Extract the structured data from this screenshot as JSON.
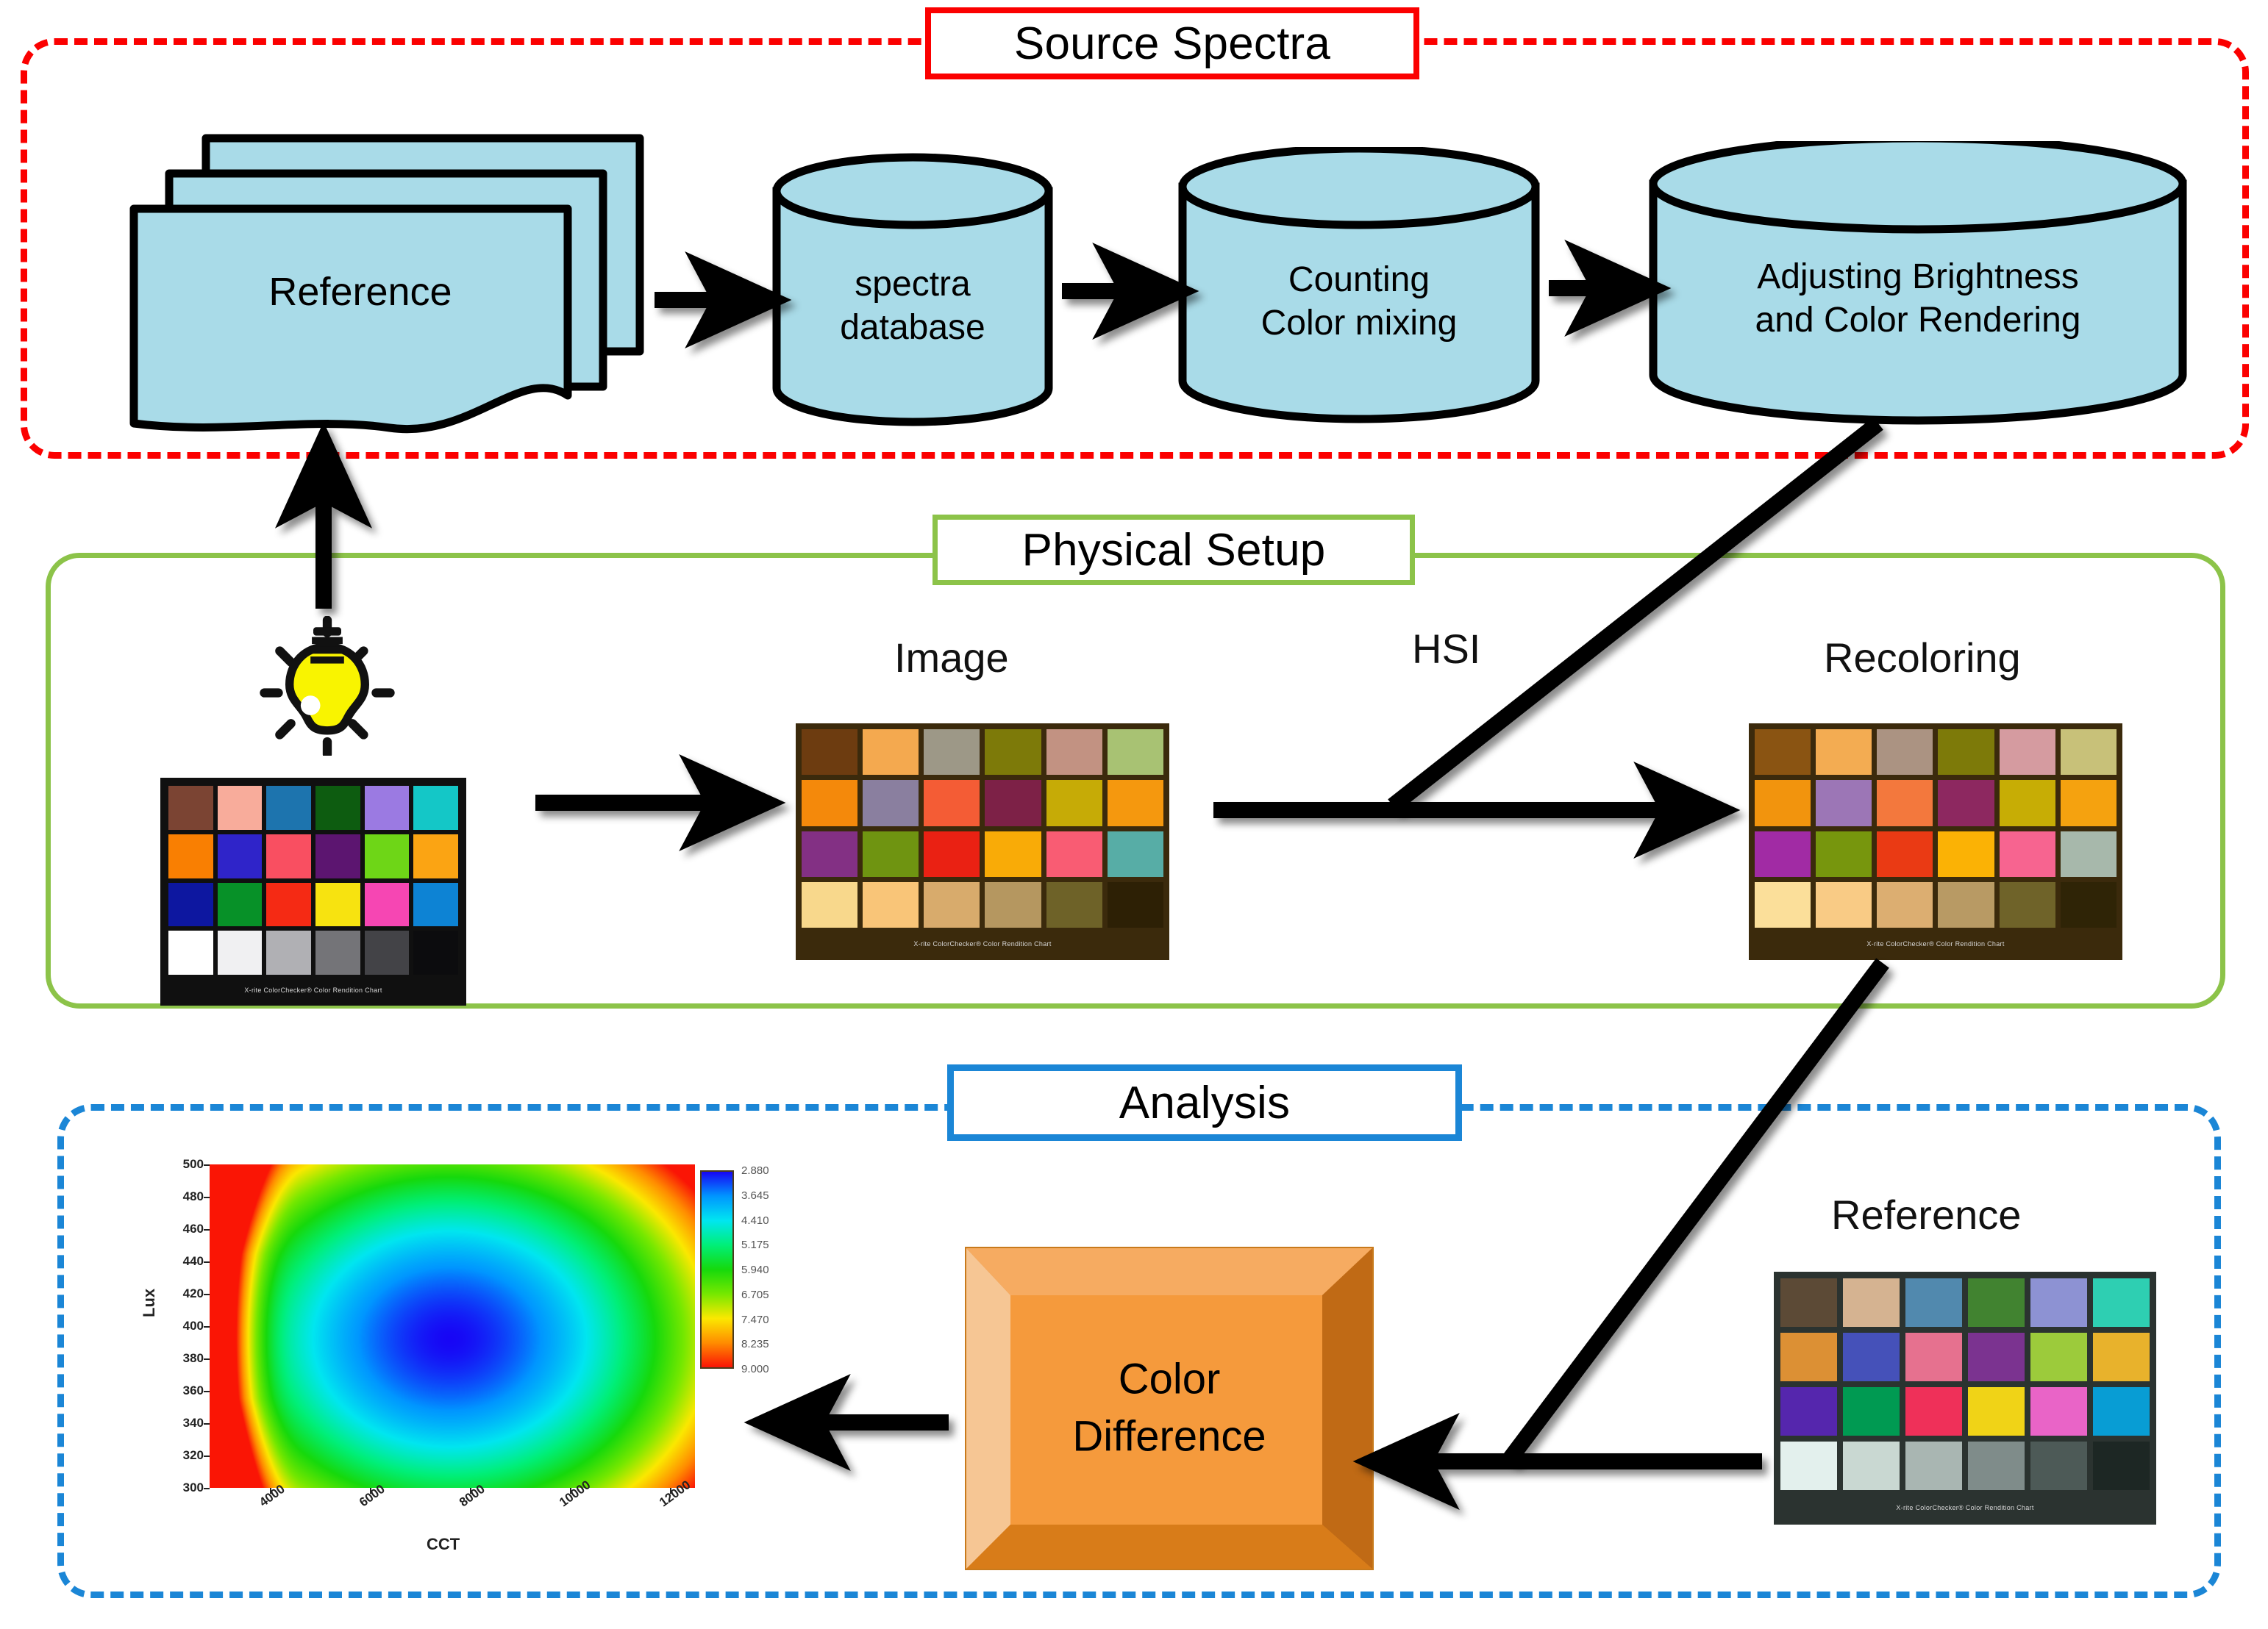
{
  "sections": {
    "source_spectra": {
      "title": "Source Spectra",
      "accent": "#fb0000"
    },
    "physical_setup": {
      "title": "Physical Setup",
      "accent": "#8cc349"
    },
    "analysis": {
      "title": "Analysis",
      "accent": "#1b86d6"
    }
  },
  "source_spectra": {
    "reference_stack_label": "Reference",
    "nodes": [
      {
        "label_line1": "spectra",
        "label_line2": "database"
      },
      {
        "label_line1": "Counting",
        "label_line2": "Color mixing"
      },
      {
        "label_line1": "Adjusting Brightness",
        "label_line2": "and Color Rendering"
      }
    ]
  },
  "physical_setup": {
    "bulb_label": "light-bulb",
    "image_label": "Image",
    "hsi_label": "HSI",
    "recoloring_label": "Recoloring"
  },
  "analysis": {
    "color_difference_line1": "Color",
    "color_difference_line2": "Difference",
    "reference_label": "Reference"
  },
  "colorchecker": {
    "footer": "X-rite ColorChecker® Color Rendition Chart",
    "reference_lit": [
      "#7b4433",
      "#f8ac9b",
      "#1d74ae",
      "#0d5c10",
      "#9b7ae2",
      "#14c7c7",
      "#f97f02",
      "#2f24c9",
      "#f94f61",
      "#5c1570",
      "#6ed617",
      "#fba413",
      "#0d17a0",
      "#079128",
      "#f52a14",
      "#f7e310",
      "#f646b3",
      "#0d83d4",
      "#ffffff",
      "#f0f0f2",
      "#b0b0b4",
      "#747478",
      "#434347",
      "#0c0c0e"
    ],
    "image_captured": [
      "#6d3c10",
      "#f4a94f",
      "#9d9887",
      "#7d7a09",
      "#c29282",
      "#a8c273",
      "#f4890b",
      "#8a7f9f",
      "#f45c35",
      "#7d2147",
      "#c6ab06",
      "#f5980e",
      "#833084",
      "#6f9411",
      "#ea2113",
      "#f9ab07",
      "#f95c73",
      "#57ada6",
      "#f8d88c",
      "#f9c578",
      "#d8ab6c",
      "#b59760",
      "#6e6228",
      "#2d2005"
    ],
    "recolored": [
      "#8a5412",
      "#f3ac52",
      "#ab9382",
      "#7d7a09",
      "#d59ba0",
      "#c8c179",
      "#f2940d",
      "#9c76b6",
      "#f3783d",
      "#8d2860",
      "#c7ad05",
      "#f5a20f",
      "#a12ba4",
      "#77960d",
      "#ea3a14",
      "#fbb205",
      "#f76490",
      "#a7b8ab",
      "#fbdf9a",
      "#f9cb85",
      "#dcae71",
      "#b89a64",
      "#6f6329",
      "#2f2406"
    ],
    "reference_unlit": [
      "#5c4a36",
      "#d5b391",
      "#5189ae",
      "#418330",
      "#8d92d3",
      "#2ecfb2",
      "#dc9034",
      "#4551b9",
      "#e6718f",
      "#7b3390",
      "#9ccb3b",
      "#e8b22c",
      "#5526ad",
      "#009a52",
      "#ef3059",
      "#f0d317",
      "#e964c7",
      "#089dd4",
      "#e3f0ed",
      "#c9d8d2",
      "#a9b6b2",
      "#7f8c8a",
      "#4d5a57",
      "#1d2724"
    ]
  },
  "chart_data": {
    "type": "heatmap",
    "title": "",
    "xlabel": "CCT",
    "ylabel": "Lux",
    "xticks": [
      4000,
      6000,
      8000,
      10000,
      12000
    ],
    "yticks": [
      300,
      320,
      340,
      360,
      380,
      400,
      420,
      440,
      460,
      480,
      500
    ],
    "xlim": [
      2800,
      12500
    ],
    "ylim": [
      300,
      500
    ],
    "colorbar_labels": [
      "2.880",
      "3.645",
      "4.410",
      "5.175",
      "5.940",
      "6.705",
      "7.470",
      "8.235",
      "9.000"
    ],
    "colorbar_min": 2.88,
    "colorbar_max": 9.0,
    "colorbar_colors": [
      "#1706f5",
      "#0096ff",
      "#00e6f0",
      "#00ef78",
      "#16d90c",
      "#76e800",
      "#fbe800",
      "#ff8c00",
      "#fa1505"
    ],
    "zlabel": "Color difference",
    "minimum": {
      "x": 7600,
      "y": 392,
      "value": 2.88
    },
    "description": "Contour map of colour difference over CCT and Lux; minimum near CCT 7600 K, 392 Lux; values rise toward the low-CCT left edge (up to 9.0)."
  }
}
